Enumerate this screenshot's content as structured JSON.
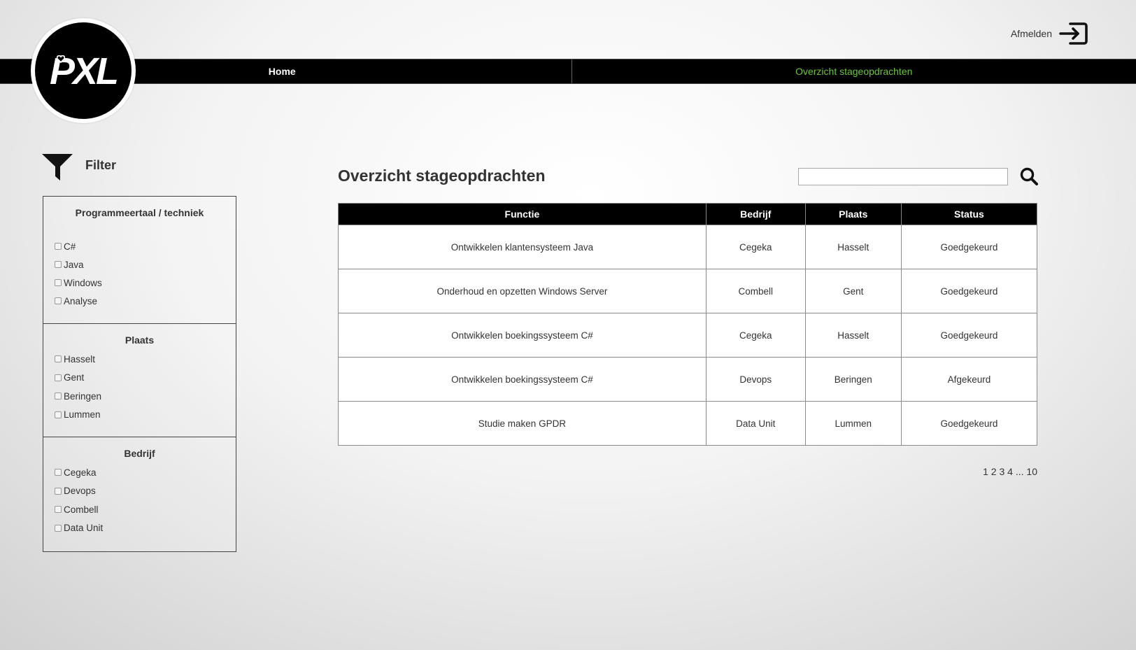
{
  "header": {
    "logo_text": "PXL",
    "logout_label": "Afmelden"
  },
  "nav": {
    "home": "Home",
    "overview": "Overzicht stageopdrachten"
  },
  "filter": {
    "title": "Filter",
    "sections": [
      {
        "title": "Programmeertaal / techniek",
        "options": [
          "C#",
          "Java",
          "Windows",
          "Analyse"
        ]
      },
      {
        "title": "Plaats",
        "options": [
          "Hasselt",
          "Gent",
          "Beringen",
          "Lummen"
        ]
      },
      {
        "title": "Bedrijf",
        "options": [
          "Cegeka",
          "Devops",
          "Combell",
          "Data Unit"
        ]
      }
    ]
  },
  "main": {
    "title": "Overzicht stageopdrachten",
    "search_value": "",
    "columns": [
      "Functie",
      "Bedrijf",
      "Plaats",
      "Status"
    ],
    "rows": [
      {
        "functie": "Ontwikkelen klantensysteem Java",
        "bedrijf": "Cegeka",
        "plaats": "Hasselt",
        "status": "Goedgekeurd"
      },
      {
        "functie": "Onderhoud en opzetten Windows Server",
        "bedrijf": "Combell",
        "plaats": "Gent",
        "status": "Goedgekeurd"
      },
      {
        "functie": "Ontwikkelen boekingssysteem C#",
        "bedrijf": "Cegeka",
        "plaats": "Hasselt",
        "status": "Goedgekeurd"
      },
      {
        "functie": "Ontwikkelen boekingssysteem C#",
        "bedrijf": "Devops",
        "plaats": "Beringen",
        "status": "Afgekeurd"
      },
      {
        "functie": "Studie maken GPDR",
        "bedrijf": "Data Unit",
        "plaats": "Lummen",
        "status": "Goedgekeurd"
      }
    ],
    "pagination": [
      "1",
      "2",
      "3",
      "4",
      "...",
      "10"
    ]
  },
  "colors": {
    "approved": "#4aa82e",
    "rejected": "#e0161c",
    "nav_active": "#6ec43a",
    "nav_bg": "#000000"
  },
  "icons": {
    "logout": "logout-icon",
    "filter": "filter-funnel-icon",
    "search": "search-icon"
  }
}
